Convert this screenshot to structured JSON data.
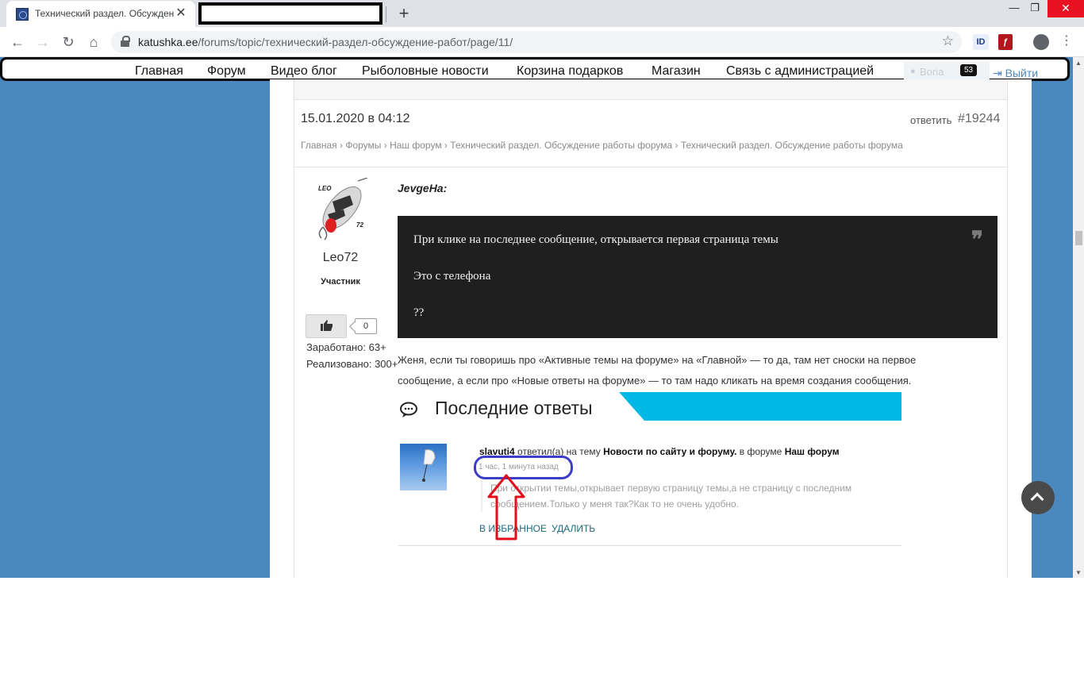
{
  "browser": {
    "tab_title": "Технический раздел. Обсужден",
    "new_tab_symbol": "+",
    "url_domain": "katushka.ee",
    "url_path": "/forums/topic/технический-раздел-обсуждение-работ/page/11/",
    "ext_id_label": "ID"
  },
  "site_nav": {
    "items": [
      "Главная",
      "Форум",
      "Видео блог",
      "Рыболовные новости",
      "Корзина подарков",
      "Магазин",
      "Связь с администрацией"
    ],
    "username": "Boria",
    "notif_count": "53",
    "logout": "Выйти"
  },
  "post": {
    "date": "15.01.2020 в 04:12",
    "reply_label": "ответить",
    "number": "#19244",
    "breadcrumbs": "Главная › Форумы › Наш форум › Технический раздел. Обсуждение работы форума › Технический раздел. Обсуждение работы форума",
    "author": {
      "avatar_text_top": "LEO",
      "avatar_text_num": "72",
      "name": "Leo72",
      "role": "Участник",
      "likes": "0",
      "earned": "Заработано: 63+",
      "sold": "Реализовано: 300+"
    },
    "quote_author": "JevgeHa:",
    "quote_lines": [
      "При клике на последнее сообщение, открывается первая страница темы",
      "Это с телефона",
      "??"
    ],
    "reply_text": "Женя, если ты говоришь про «Активные темы на форуме» на «Главной» — то да, там нет сноски на первое сообщение, а если про «Новые ответы на форуме» — то там надо кликать на время создания сообщения."
  },
  "latest_replies": {
    "title": "Последние ответы",
    "item": {
      "user": "slavuti4",
      "action": " ответил(а) на тему ",
      "topic": "Новости по сайту и форуму.",
      "in_forum": " в форуме ",
      "forum": "Наш форум",
      "time": "1 час, 1 минута назад",
      "excerpt": "При открытии темы,открывает первую страницу темы,а не страницу с последним сообщением.Только у меня так?Как то не очень удобно.",
      "favorite": "В ИЗБРАННОЕ",
      "delete": "УДАЛИТЬ"
    }
  },
  "colors": {
    "page_bg": "#4a88be",
    "accent_stripe": "#00b8e6",
    "annotation_ellipse": "#3d3dc8",
    "annotation_arrow": "#e0101a"
  },
  "icons": [
    "back-arrow-icon",
    "forward-arrow-icon",
    "reload-icon",
    "home-icon",
    "lock-icon",
    "star-icon",
    "profile-icon",
    "menu-dots-icon",
    "thumbs-up-icon",
    "quote-icon",
    "chat-bubble-icon",
    "scroll-top-icon"
  ]
}
